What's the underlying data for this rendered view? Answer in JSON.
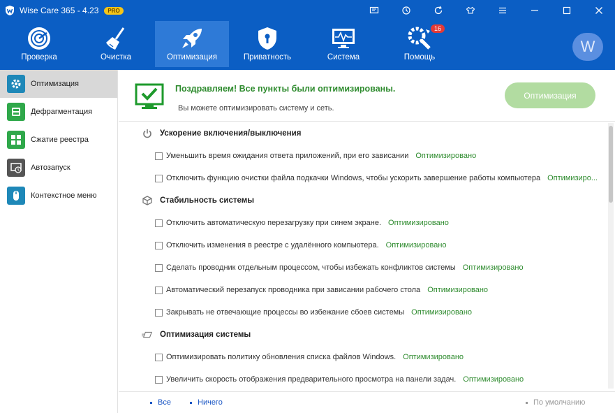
{
  "window": {
    "title": "Wise Care 365 - 4.23",
    "badge": "PRO"
  },
  "titlebar_icons": [
    "feedback-icon",
    "update-icon",
    "refresh-icon",
    "skin-icon",
    "menu-icon",
    "minimize-icon",
    "maximize-icon",
    "close-icon"
  ],
  "toolbar": {
    "items": [
      {
        "label": "Проверка",
        "icon": "radar-icon"
      },
      {
        "label": "Очистка",
        "icon": "broom-icon"
      },
      {
        "label": "Оптимизация",
        "icon": "rocket-icon"
      },
      {
        "label": "Приватность",
        "icon": "shield-icon"
      },
      {
        "label": "Система",
        "icon": "monitor-pulse-icon"
      },
      {
        "label": "Помощь",
        "icon": "tools-icon"
      }
    ],
    "help_badge": "16",
    "avatar_letter": "W"
  },
  "sidebar": {
    "items": [
      {
        "label": "Оптимизация",
        "icon": "optimize-icon",
        "color": "#1e88b8"
      },
      {
        "label": "Дефрагментация",
        "icon": "defrag-icon",
        "color": "#2fa84a"
      },
      {
        "label": "Сжатие реестра",
        "icon": "registry-icon",
        "color": "#2fa84a"
      },
      {
        "label": "Автозапуск",
        "icon": "autorun-icon",
        "color": "#555555"
      },
      {
        "label": "Контекстное меню",
        "icon": "mouse-icon",
        "color": "#1e88b8"
      }
    ]
  },
  "header": {
    "title": "Поздравляем! Все пункты были оптимизированы.",
    "subtitle": "Вы можете оптимизировать систему и сеть.",
    "button": "Оптимизация"
  },
  "sections": [
    {
      "title": "Ускорение включения/выключения",
      "icon": "power-icon",
      "items": [
        {
          "text": "Уменьшить время ожидания ответа приложений, при его зависании",
          "status": "Оптимизировано"
        },
        {
          "text": "Отключить функцию очистки файла подкачки Windows, чтобы ускорить завершение работы компьютера",
          "status": "Оптимизиро..."
        }
      ]
    },
    {
      "title": "Стабильность системы",
      "icon": "cube-icon",
      "items": [
        {
          "text": "Отключить автоматическую перезагрузку при синем экране.",
          "status": "Оптимизировано"
        },
        {
          "text": "Отключить изменения в реестре с удалённого компьютера.",
          "status": "Оптимизировано"
        },
        {
          "text": "Сделать проводник отдельным процессом, чтобы избежать конфликтов системы",
          "status": "Оптимизировано"
        },
        {
          "text": "Автоматический перезапуск проводника при зависании рабочего стола",
          "status": "Оптимизировано"
        },
        {
          "text": "Закрывать не отвечающие процессы во избежание сбоев системы",
          "status": "Оптимизировано"
        }
      ]
    },
    {
      "title": "Оптимизация системы",
      "icon": "speed-lines-icon",
      "items": [
        {
          "text": "Оптимизировать политику обновления списка файлов Windows.",
          "status": "Оптимизировано"
        },
        {
          "text": "Увеличить скорость отображения предварительного просмотра на панели задач.",
          "status": "Оптимизировано"
        }
      ]
    }
  ],
  "footer": {
    "all": "Все",
    "none": "Ничего",
    "default": "По умолчанию"
  }
}
